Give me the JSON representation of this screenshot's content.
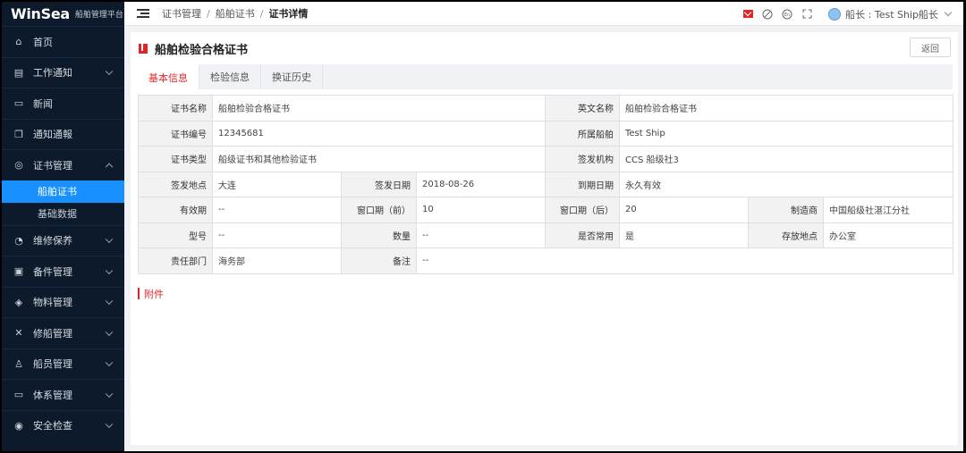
{
  "app": {
    "brand": "WinSea",
    "subtitle": "船舶管理平台"
  },
  "sidebar": {
    "items": [
      {
        "label": "首页",
        "icon": "home-icon",
        "glyph": "⌂",
        "expandable": false
      },
      {
        "label": "工作通知",
        "icon": "notice-icon",
        "glyph": "▤",
        "expandable": true
      },
      {
        "label": "新闻",
        "icon": "news-icon",
        "glyph": "▭",
        "expandable": false
      },
      {
        "label": "通知通報",
        "icon": "bulletin-icon",
        "glyph": "❐",
        "expandable": false
      },
      {
        "label": "证书管理",
        "icon": "certificate-icon",
        "glyph": "◎",
        "expandable": true,
        "expanded": true,
        "children": [
          {
            "label": "船舶证书",
            "active": true
          },
          {
            "label": "基础数据",
            "active": false
          }
        ]
      },
      {
        "label": "维修保养",
        "icon": "maintenance-icon",
        "glyph": "◔",
        "expandable": true
      },
      {
        "label": "备件管理",
        "icon": "spare-parts-icon",
        "glyph": "▣",
        "expandable": true
      },
      {
        "label": "物料管理",
        "icon": "materials-icon",
        "glyph": "◈",
        "expandable": true
      },
      {
        "label": "修船管理",
        "icon": "repair-icon",
        "glyph": "✕",
        "expandable": true
      },
      {
        "label": "船员管理",
        "icon": "crew-icon",
        "glyph": "♙",
        "expandable": true
      },
      {
        "label": "体系管理",
        "icon": "system-icon",
        "glyph": "▭",
        "expandable": true
      },
      {
        "label": "安全检查",
        "icon": "safety-icon",
        "glyph": "◉",
        "expandable": true
      }
    ]
  },
  "header": {
    "breadcrumb": [
      "证书管理",
      "船舶证书",
      "证书详情"
    ],
    "user": "船长 : Test Ship船长",
    "icons": [
      "mail-icon",
      "compass-icon",
      "language-icon",
      "fullscreen-icon"
    ]
  },
  "page": {
    "title": "船舶检验合格证书",
    "back_label": "返回",
    "tabs": [
      "基本信息",
      "检验信息",
      "换证历史"
    ],
    "active_tab": 0,
    "attachments_label": "附件"
  },
  "info": {
    "cert_name_label": "证书名称",
    "cert_name": "船舶检验合格证书",
    "en_name_label": "英文名称",
    "en_name": "船舶检验合格证书",
    "cert_no_label": "证书编号",
    "cert_no": "12345681",
    "ship_label": "所属船舶",
    "ship": "Test Ship",
    "cert_type_label": "证书类型",
    "cert_type": "船级证书和其他检验证书",
    "issuer_label": "签发机构",
    "issuer": "CCS 船级社3",
    "issue_place_label": "签发地点",
    "issue_place": "大连",
    "issue_date_label": "签发日期",
    "issue_date": "2018-08-26",
    "expiry_label": "到期日期",
    "expiry": "永久有效",
    "validity_label": "有效期",
    "validity": "--",
    "window_before_label": "窗口期（前）",
    "window_before": "10",
    "window_after_label": "窗口期（后）",
    "window_after": "20",
    "maker_label": "制造商",
    "maker": "中国船级社湛江分社",
    "model_label": "型号",
    "model": "--",
    "qty_label": "数量",
    "qty": "--",
    "common_label": "是否常用",
    "common": "是",
    "location_label": "存放地点",
    "location": "办公室",
    "dept_label": "责任部门",
    "dept": "海务部",
    "remark_label": "备注",
    "remark": "--"
  }
}
